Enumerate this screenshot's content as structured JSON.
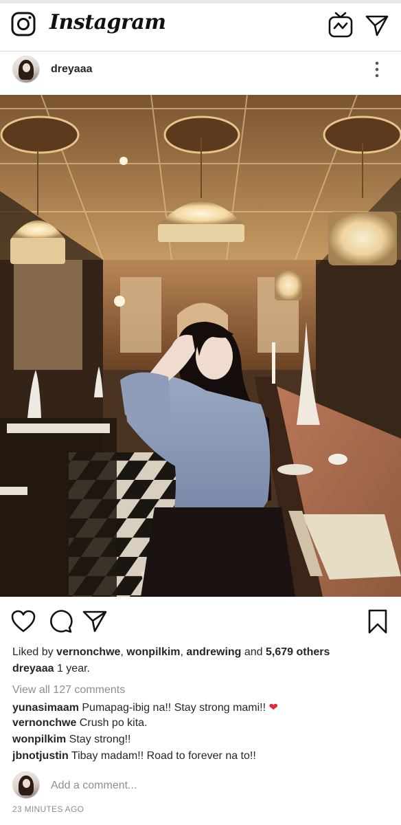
{
  "app": {
    "logo_text": "Instagram"
  },
  "topbar": {
    "icons": [
      "camera-icon",
      "igtv-icon",
      "direct-message-icon"
    ]
  },
  "post": {
    "username": "dreyaaa",
    "more_icon": "more-vertical-icon",
    "likes": {
      "prefix": "Liked by ",
      "users": [
        "vernonchwe",
        "wonpilkim",
        "andrewing"
      ],
      "connector": " and ",
      "others": "5,679 others"
    },
    "caption": {
      "username": "dreyaaa",
      "text": " 1 year."
    },
    "view_all_comments": "View all 127 comments",
    "comments": [
      {
        "username": "yunasimaam",
        "text": " Pumapag-ibig na!! Stay strong mami!! ",
        "emoji": "❤"
      },
      {
        "username": "vernonchwe",
        "text": " Crush po kita."
      },
      {
        "username": "wonpilkim",
        "text": " Stay strong!!"
      },
      {
        "username": "jbnotjustin",
        "text": " Tibay madam!! Road to forever na to!!"
      }
    ],
    "add_comment_placeholder": "Add a comment...",
    "timestamp": "23 MINUTES AGO"
  },
  "colors": {
    "text": "#262626",
    "muted": "#8e8e8e",
    "border": "#dbdbdb",
    "heart": "#e02a35"
  }
}
